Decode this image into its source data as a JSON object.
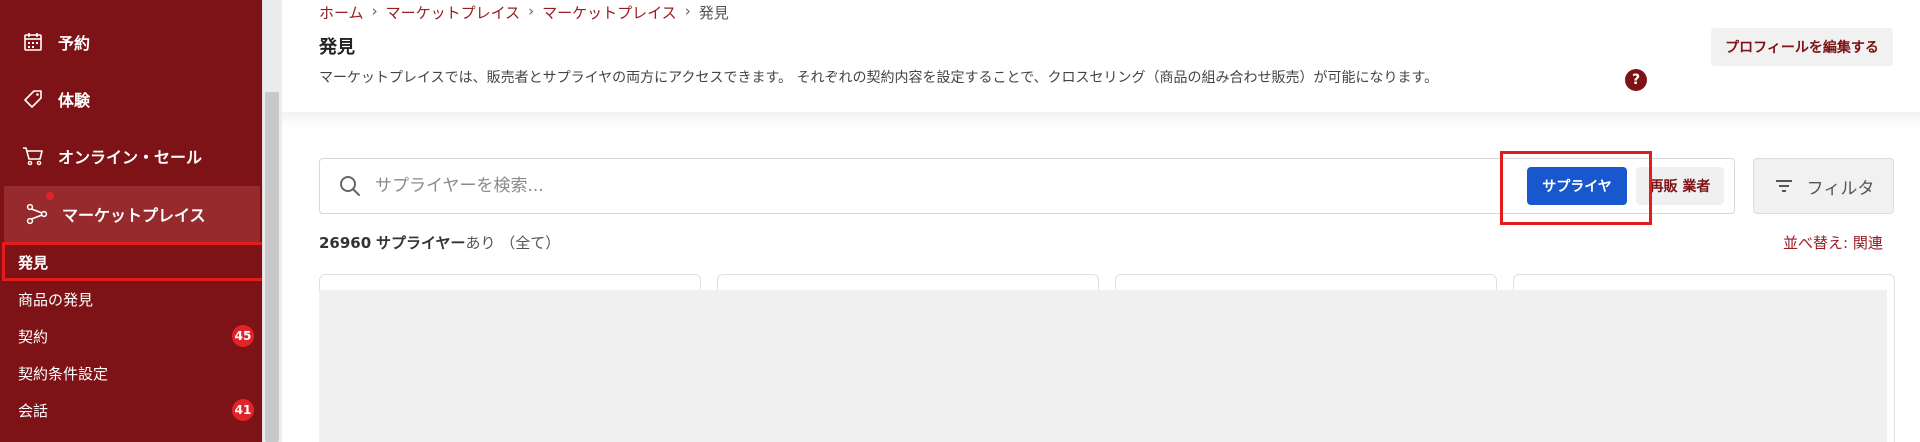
{
  "sidebar": {
    "items": [
      {
        "label": "予約",
        "icon": "calendar-icon"
      },
      {
        "label": "体験",
        "icon": "tag-icon"
      },
      {
        "label": "オンライン・セール",
        "icon": "cart-icon"
      },
      {
        "label": "マーケットプレイス",
        "icon": "network-icon"
      }
    ],
    "subitems": [
      {
        "label": "発見"
      },
      {
        "label": "商品の発見"
      },
      {
        "label": "契約",
        "badge": "45"
      },
      {
        "label": "契約条件設定"
      },
      {
        "label": "会話",
        "badge": "41"
      }
    ]
  },
  "breadcrumb": [
    "ホーム",
    "マーケットプレイス",
    "マーケットプレイス",
    "発見"
  ],
  "page": {
    "title": "発見",
    "description": "マーケットプレイスでは、販売者とサプライヤの両方にアクセスできます。 それぞれの契約内容を設定することで、クロスセリング（商品の組み合わせ販売）が可能になります。",
    "help": "?",
    "edit_profile_label": "プロフィールを編集する"
  },
  "search": {
    "placeholder": "サプライヤーを検索...",
    "value": ""
  },
  "toggle": {
    "supplier_label": "サプライヤ",
    "reseller_label": "再販 業者"
  },
  "filter_label": "フィルタ",
  "results": {
    "count": "26960",
    "type": "サプライヤー",
    "suffix": "あり （全て）"
  },
  "sort_label": "並べ替え: 関連",
  "colors": {
    "sidebar": "#7d1316",
    "accent": "#9a1c22",
    "primary_button": "#1957cf",
    "badge": "#e0242a"
  }
}
